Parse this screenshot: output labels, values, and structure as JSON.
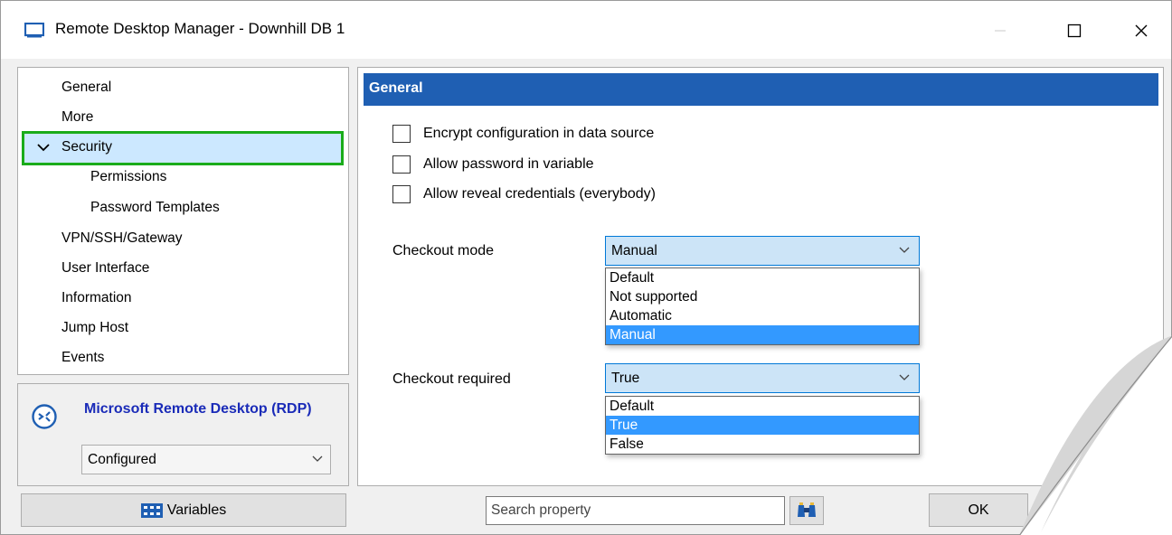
{
  "window": {
    "title": "Remote Desktop Manager - Downhill DB 1",
    "controls": {
      "minimize": "—",
      "maximize": "☐",
      "close": "✕"
    }
  },
  "nav": {
    "items": [
      {
        "label": "General"
      },
      {
        "label": "More"
      },
      {
        "label": "Security",
        "selected": true,
        "expanded": true
      },
      {
        "label": "Permissions",
        "child": true
      },
      {
        "label": "Password Templates",
        "child": true
      },
      {
        "label": "VPN/SSH/Gateway"
      },
      {
        "label": "User Interface"
      },
      {
        "label": "Information"
      },
      {
        "label": "Jump Host"
      },
      {
        "label": "Events"
      }
    ]
  },
  "connection": {
    "title": "Microsoft Remote Desktop (RDP)",
    "status": "Configured"
  },
  "content": {
    "header": "General",
    "checkboxes": [
      {
        "label": "Encrypt configuration in data source",
        "checked": false
      },
      {
        "label": "Allow password in variable",
        "checked": false
      },
      {
        "label": "Allow reveal credentials (everybody)",
        "checked": false
      }
    ],
    "checkout_mode": {
      "label": "Checkout mode",
      "value": "Manual",
      "options": [
        "Default",
        "Not supported",
        "Automatic",
        "Manual"
      ],
      "selected_index": 3
    },
    "checkout_required": {
      "label": "Checkout required",
      "value": "True",
      "options": [
        "Default",
        "True",
        "False"
      ],
      "selected_index": 1
    }
  },
  "footer": {
    "variables_label": "Variables",
    "search_placeholder": "Search property",
    "ok_label": "OK"
  },
  "colors": {
    "accent": "#1f5fb3",
    "selection": "#cce8ff",
    "highlight_border": "#1aac1a",
    "dropdown_selected": "#3399ff",
    "connection_title": "#1a2bb8"
  }
}
